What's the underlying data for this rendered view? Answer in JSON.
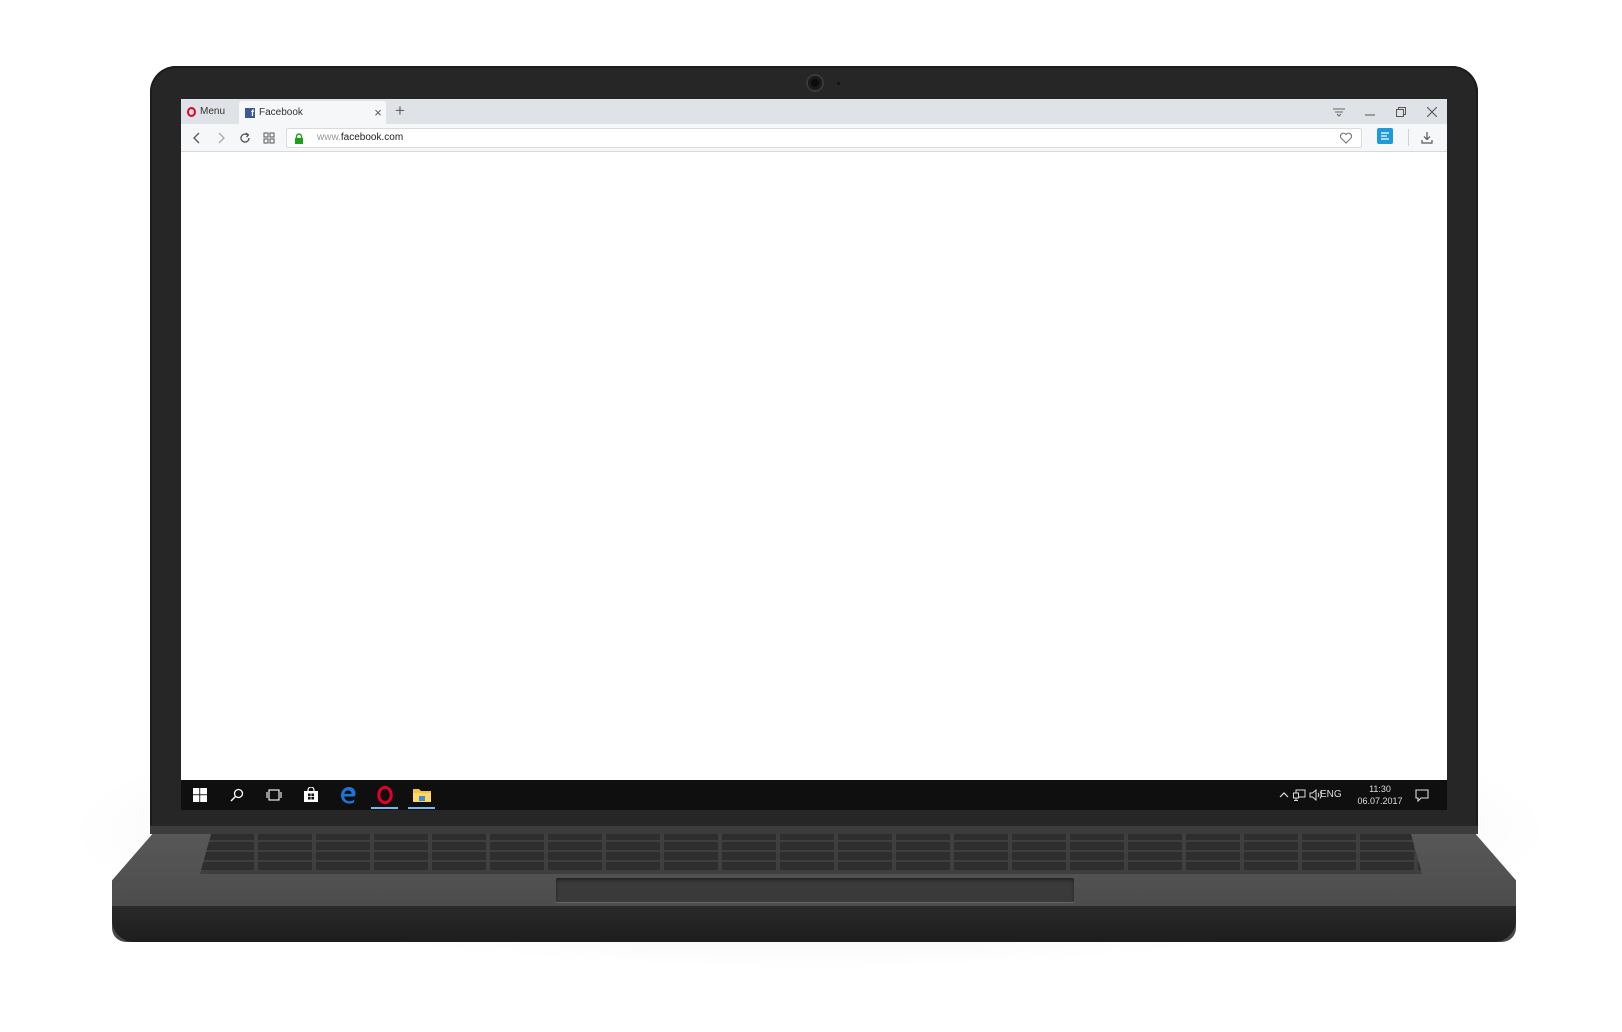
{
  "browser": {
    "menu_label": "Menu",
    "tab": {
      "title": "Facebook",
      "favicon_letter": "f"
    },
    "new_tab_symbol": "+",
    "close_tab_symbol": "×",
    "url": {
      "prefix": "www.",
      "domain": "facebook.com"
    }
  },
  "taskbar": {
    "apps": [
      {
        "name": "start",
        "icon": "windows-logo-icon"
      },
      {
        "name": "search",
        "icon": "search-icon"
      },
      {
        "name": "task-view",
        "icon": "task-view-icon"
      },
      {
        "name": "store",
        "icon": "store-bag-icon"
      },
      {
        "name": "edge",
        "icon": "edge-icon"
      },
      {
        "name": "opera",
        "icon": "opera-icon",
        "running": true
      },
      {
        "name": "file-explorer",
        "icon": "folder-icon",
        "running": true
      }
    ],
    "tray": {
      "language": "ENG",
      "time": "11:30",
      "date": "06.07.2017"
    }
  },
  "colors": {
    "opera_red": "#e4002b",
    "facebook_blue": "#3b5998",
    "edge_blue": "#1e74d6",
    "secure_green": "#19a319",
    "taskbar_bg": "#0f0f10",
    "running_indicator": "#76b9ed"
  }
}
